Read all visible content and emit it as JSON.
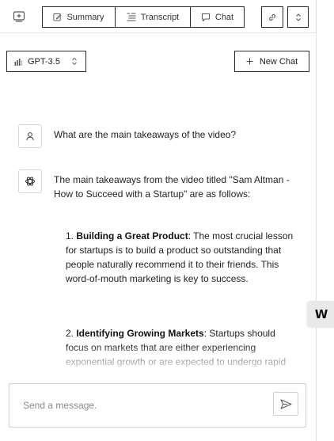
{
  "toolbar": {
    "summary_label": "Summary",
    "transcript_label": "Transcript",
    "chat_label": "Chat",
    "icons": {
      "left": "add-screen-icon",
      "summary": "edit-icon",
      "transcript": "align-lines-icon",
      "chat": "chat-bubble-icon",
      "link": "link-icon",
      "expand": "chevron-up-down-icon"
    }
  },
  "model": {
    "selected": "GPT-3.5",
    "icon": "bar-chart-icon"
  },
  "new_chat": {
    "label": "New Chat",
    "icon": "plus-icon"
  },
  "messages": {
    "user": {
      "text": "What are the main takeaways of the video?",
      "avatar_icon": "user-icon"
    },
    "assistant": {
      "avatar_icon": "openai-icon",
      "intro": "The main takeaways from the video titled \"Sam Altman - How to Succeed with a Startup\" are as follows:",
      "items": [
        {
          "num": "1. ",
          "title": "Building a Great Product",
          "text": ": The most crucial lesson for startups is to build a product so outstanding that people naturally recommend it to their friends. This word-of-mouth marketing is key to success."
        },
        {
          "num": "2. ",
          "title": "Identifying Growing Markets",
          "text": ": Startups should focus on markets that are either experiencing exponential growth or are expected to undergo rapid expansion in the near future. Identifying these"
        }
      ]
    }
  },
  "input": {
    "placeholder": "Send a message.",
    "value": "",
    "send_icon": "send-icon"
  },
  "side_tab": {
    "label": "W"
  },
  "colors": {
    "border_dark": "#2a2a2a",
    "border_light": "#d4d4d4",
    "side_tab_bg": "#e9e9e9"
  }
}
